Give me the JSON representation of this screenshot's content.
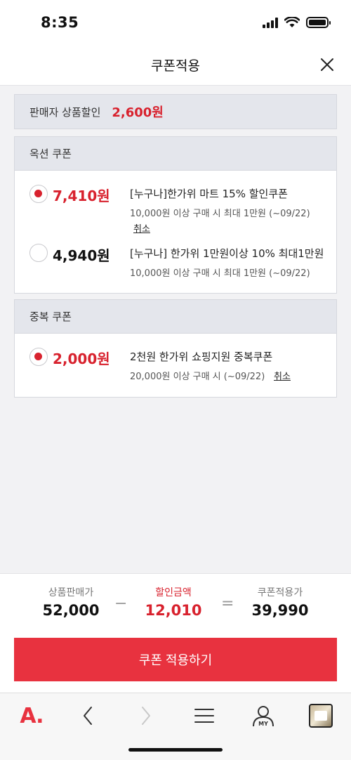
{
  "status": {
    "time": "8:35"
  },
  "header": {
    "title": "쿠폰적용"
  },
  "seller_discount": {
    "label": "판매자 상품할인",
    "amount": "2,600원"
  },
  "option_coupons": {
    "heading": "옥션 쿠폰",
    "items": [
      {
        "amount": "7,410원",
        "title": "[누구나]한가위 마트 15% 할인쿠폰",
        "condition": "10,000원 이상 구매 시 최대 1만원 (~09/22)",
        "cancel": "취소",
        "selected": true
      },
      {
        "amount": "4,940원",
        "title": "[누구나] 한가위 1만원이상 10% 최대1만원",
        "condition": "10,000원 이상 구매 시 최대 1만원 (~09/22)",
        "selected": false
      }
    ]
  },
  "dup_coupons": {
    "heading": "중복 쿠폰",
    "items": [
      {
        "amount": "2,000원",
        "title": "2천원 한가위 쇼핑지원 중복쿠폰",
        "condition": "20,000원 이상 구매 시 (~09/22)",
        "cancel": "취소",
        "selected": true
      }
    ]
  },
  "summary": {
    "price_label": "상품판매가",
    "price": "52,000",
    "minus": "−",
    "discount_label": "할인금액",
    "discount": "12,010",
    "equals": "=",
    "final_label": "쿠폰적용가",
    "final": "39,990"
  },
  "apply_button": "쿠폰 적용하기",
  "bottom_nav": {
    "logo": "A.",
    "my_label": "MY",
    "icons": [
      "auction-logo-icon",
      "back-arrow-icon",
      "forward-arrow-icon",
      "menu-icon",
      "my-page-icon",
      "recent-item-thumbnail"
    ]
  },
  "colors": {
    "accent": "#d8222e",
    "button": "#e8323f",
    "section_bg": "#e4e6ec"
  }
}
